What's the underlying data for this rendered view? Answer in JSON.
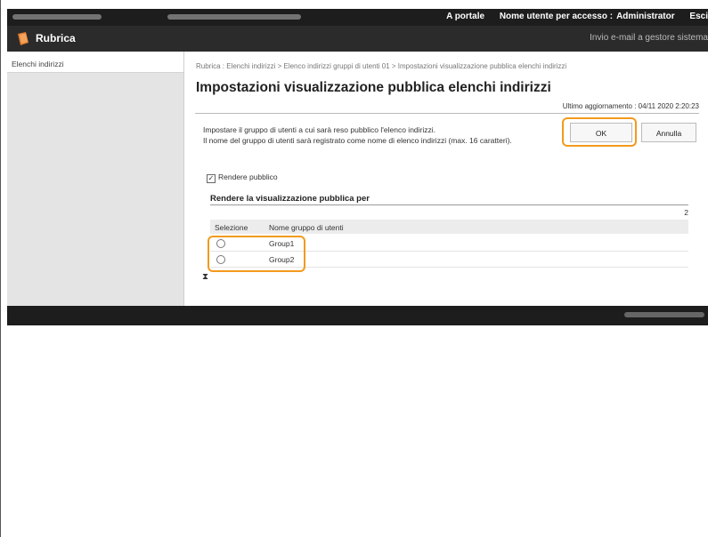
{
  "topbar": {
    "portal_link": "A portale",
    "login_user_label": "Nome utente per accesso :",
    "login_user_value": "Administrator",
    "logout_label": "Esci"
  },
  "app": {
    "title": "Rubrica",
    "email_admin_link": "Invio e-mail a gestore sistema"
  },
  "sidebar": {
    "items": [
      {
        "label": "Elenchi indirizzi"
      }
    ]
  },
  "main": {
    "breadcrumb": "Rubrica : Elenchi indirizzi > Elenco indirizzi gruppi di utenti 01 > Impostazioni visualizzazione pubblica elenchi indirizzi",
    "title": "Impostazioni visualizzazione pubblica elenchi indirizzi",
    "last_updated_label": "Ultimo aggiornamento : 04/11 2020 2:20:23",
    "description_line1": "Impostare il gruppo di utenti a cui sarà reso pubblico l'elenco indirizzi.",
    "description_line2": "Il nome del gruppo di utenti sarà registrato come nome di elenco indirizzi (max. 16 caratteri).",
    "ok_label": "OK",
    "cancel_label": "Annulla",
    "make_public_label": "Rendere pubblico",
    "make_public_checked": true,
    "section_title": "Rendere la visualizzazione pubblica per",
    "count": "2",
    "table": {
      "headers": [
        "Selezione",
        "Nome gruppo di utenti"
      ],
      "rows": [
        {
          "name": "Group1",
          "selected": false
        },
        {
          "name": "Group2",
          "selected": false
        }
      ]
    },
    "anchor_icon": "top-anchor-icon"
  },
  "colors": {
    "highlight": "#f29a1d",
    "topbar": "#1d1d1d",
    "header": "#2b2b2b",
    "sidebar": "#e4e4e4"
  }
}
